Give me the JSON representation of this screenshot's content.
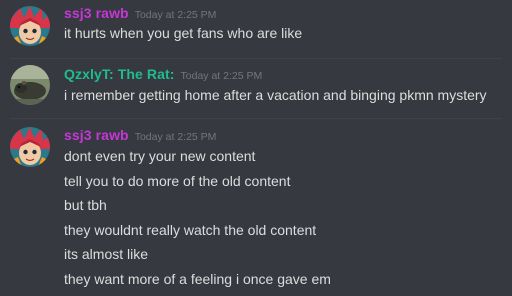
{
  "messages": [
    {
      "author": "ssj3 rawb",
      "author_color": "#c637d6",
      "timestamp": "Today at 2:25 PM",
      "avatar_icon": "anime-character-avatar",
      "lines": [
        "it hurts when you get fans who are like"
      ]
    },
    {
      "author": "QzxlyT: The Rat:",
      "author_color": "#1fbc91",
      "timestamp": "Today at 2:25 PM",
      "avatar_icon": "rat-photo-avatar",
      "lines": [
        "i remember getting home after a vacation and binging pkmn mystery"
      ]
    },
    {
      "author": "ssj3 rawb",
      "author_color": "#c637d6",
      "timestamp": "Today at 2:25 PM",
      "avatar_icon": "anime-character-avatar",
      "lines": [
        "dont even try your new content",
        "tell you to do more of the old content",
        "but tbh",
        "they wouldnt really watch the old content",
        "its almost like",
        "they want more of a feeling i once gave em"
      ]
    }
  ]
}
